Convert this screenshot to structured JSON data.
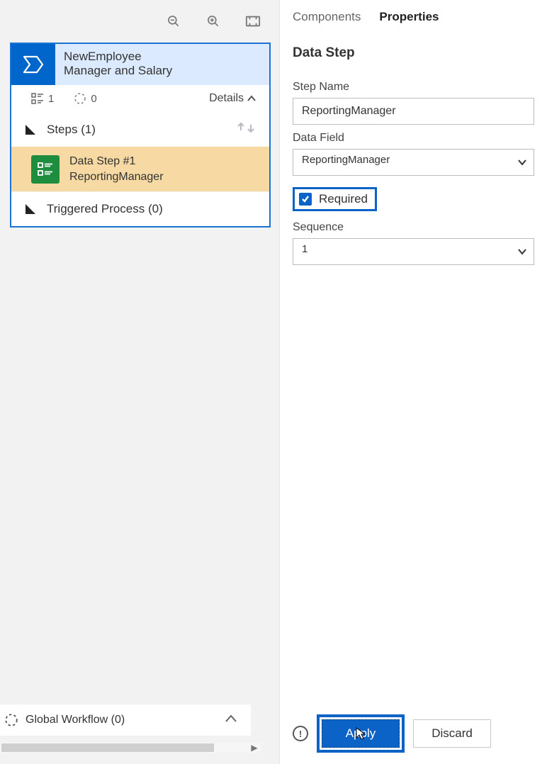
{
  "tabs": {
    "components": "Components",
    "properties": "Properties",
    "active": "properties"
  },
  "panel": {
    "section_title": "Data Step",
    "step_name_label": "Step Name",
    "step_name_value": "ReportingManager",
    "data_field_label": "Data Field",
    "data_field_value": "ReportingManager",
    "required_label": "Required",
    "required_checked": "true",
    "sequence_label": "Sequence",
    "sequence_value": "1",
    "apply_label": "Apply",
    "discard_label": "Discard"
  },
  "stage": {
    "title_line1": "NewEmployee",
    "title_line2": "Manager and Salary",
    "meta_count1": "1",
    "meta_count2": "0",
    "details_label": "Details",
    "steps_label": "Steps (1)",
    "data_step_title": "Data Step #1",
    "data_step_sub": "ReportingManager",
    "triggered_label": "Triggered Process (0)"
  },
  "global": {
    "label": "Global Workflow (0)"
  }
}
